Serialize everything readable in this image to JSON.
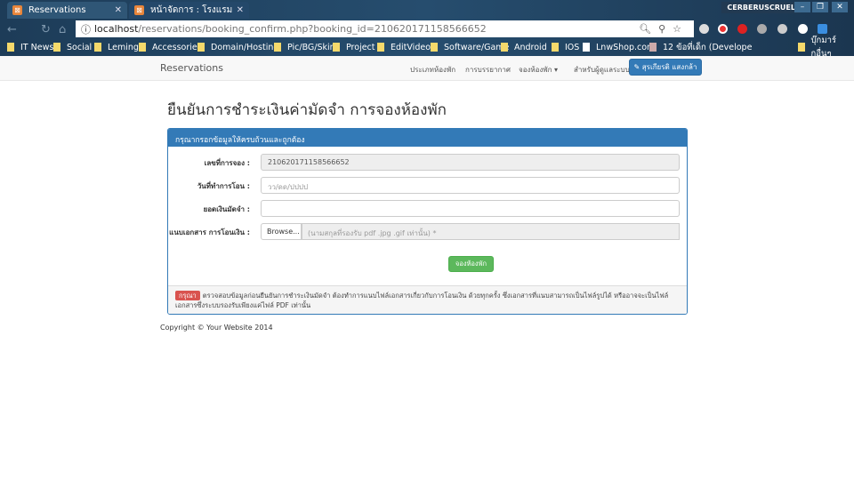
{
  "browser": {
    "tabs": [
      {
        "title": "Reservations"
      },
      {
        "title": "หน้าจัดการ : โรงแรม"
      }
    ],
    "user": "CERBERUSCRUEL",
    "url_host": "localhost",
    "url_path": "/reservations/booking_confirm.php?booking_id=210620171158566652",
    "bookmarks": [
      "IT News",
      "Social",
      "Leming",
      "Accessories",
      "Domain/Hosting",
      "Pic/BG/Skin",
      "Project",
      "EditVideo",
      "Software/Game",
      "Android",
      "IOS",
      "LnwShop.com",
      "12 ข้อที่เด็ก (Develope",
      "บุ๊กมาร์กอื่นๆ"
    ]
  },
  "navbar": {
    "brand": "Reservations",
    "links": [
      "ประเภทห้องพัก",
      "การบรรยากาศ",
      "จองห้องพัก ▾",
      "สำหรับผู้ดูแลระบบ"
    ],
    "user_button": "✎ สุรเกียรติ แสงกล้า"
  },
  "page": {
    "title": "ยืนยันการชำระเงินค่ามัดจำ การจองห้องพัก",
    "panel_heading": "กรุณากรอกข้อมูลให้ครบถ้วนและถูกต้อง",
    "fields": [
      {
        "label": "เลขที่การจอง :",
        "value": "210620171158566652"
      },
      {
        "label": "วันที่ทำการโอน :",
        "placeholder": "วว/ดด/ปปปป"
      },
      {
        "label": "ยอดเงินมัดจำ :",
        "value": ""
      },
      {
        "label": "แนบเอกสาร การโอนเงิน :",
        "browse": "Browse...",
        "file_placeholder": "(นามสกุลที่รองรับ pdf .jpg .gif เท่านั้น) *"
      }
    ],
    "submit": "จองห้องพัก",
    "notice_label": "กรุณา",
    "notice": "ตรวจสอบข้อมูลก่อนยืนยันการชำระเงินมัดจำ ต้องทำการแนบไฟล์เอกสารเกี่ยวกับการโอนเงิน ด้วยทุกครั้ง ซึ่งเอกสารที่แนบสามารถเป็นไฟล์รูปได้ หรืออาจจะเป็นไฟล์เอกสารซึ่งระบบรองรับเพียงแค่ไฟล์ PDF เท่านั้น",
    "copyright": "Copyright © Your Website 2014"
  }
}
